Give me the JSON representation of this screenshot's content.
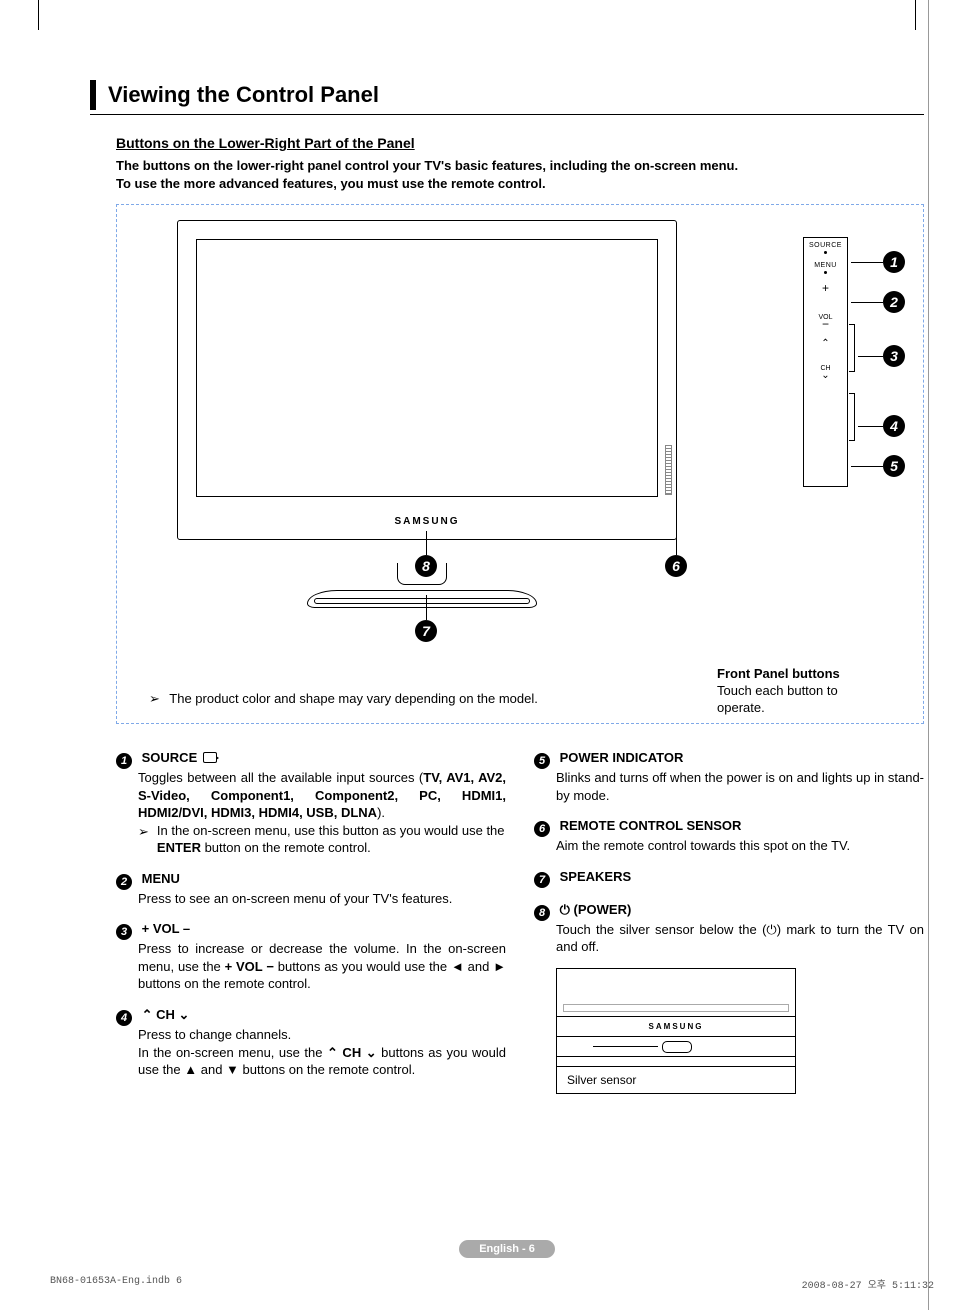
{
  "page_title": "Viewing the Control Panel",
  "subhead": "Buttons on the Lower-Right Part of the Panel",
  "intro_line1": "The buttons on the lower-right panel control your TV's basic features, including the on-screen menu.",
  "intro_line2": "To use the more advanced features, you must use the remote control.",
  "diagram": {
    "tv_brand": "SAMSUNG",
    "side_labels": {
      "source": "SOURCE",
      "menu": "MENU",
      "vol": "VOL",
      "ch": "CH"
    },
    "note_prefix": "➢",
    "note": "The product color and shape may vary depending on the model.",
    "front_panel_title": "Front Panel buttons",
    "front_panel_body": "Touch each button to operate.",
    "callouts": [
      "1",
      "2",
      "3",
      "4",
      "5",
      "6",
      "7",
      "8"
    ]
  },
  "items_left": [
    {
      "n": "1",
      "title": "SOURCE",
      "has_source_icon": true,
      "body_lines": [
        "Toggles between all the available input sources (",
        "TV, AV1, AV2, S-Video, Component1, Component2, PC, HDMI1, HDMI2/DVI, HDMI3, HDMI4, USB, DLNA",
        ")."
      ],
      "sub_arrow": "In the on-screen menu, use this button as you would use the ENTER button on the remote control.",
      "sub_bold": "ENTER"
    },
    {
      "n": "2",
      "title": "MENU",
      "body": "Press to see an on-screen menu of your TV's features."
    },
    {
      "n": "3",
      "title": "+ VOL –",
      "body_pre": "Press to increase or decrease the volume. In the on-screen menu, use the ",
      "body_bold": "+ VOL −",
      "body_post": " buttons as you would use the ◄ and ► buttons on the remote control."
    },
    {
      "n": "4",
      "title_pre": "",
      "title_caret_up": "⌃",
      "title_mid": " CH ",
      "title_caret_down": "⌄",
      "body_line1": "Press to change channels.",
      "body_line2_pre": "In the on-screen menu, use the ",
      "body_line2_sym": "⌃ CH ⌄",
      "body_line2_post": " buttons as you would use the ▲ and ▼ buttons on the remote control."
    }
  ],
  "items_right": [
    {
      "n": "5",
      "title": "POWER INDICATOR",
      "body": "Blinks and turns off when the power is on and lights up in stand-by mode."
    },
    {
      "n": "6",
      "title": "REMOTE CONTROL SENSOR",
      "body": "Aim the remote control towards this spot on the TV."
    },
    {
      "n": "7",
      "title": "SPEAKERS",
      "body": ""
    },
    {
      "n": "8",
      "title_icon": "⏻",
      "title": "(POWER)",
      "body_pre": "Touch the silver sensor below the (",
      "body_icon": "⏻",
      "body_post": ") mark to turn the TV on and off."
    }
  ],
  "silver": {
    "brand": "SAMSUNG",
    "label": "Silver sensor"
  },
  "footer_pill": "English - 6",
  "doc_footer_left": "BN68-01653A-Eng.indb   6",
  "doc_footer_right": "2008-08-27   오후 5:11:32"
}
